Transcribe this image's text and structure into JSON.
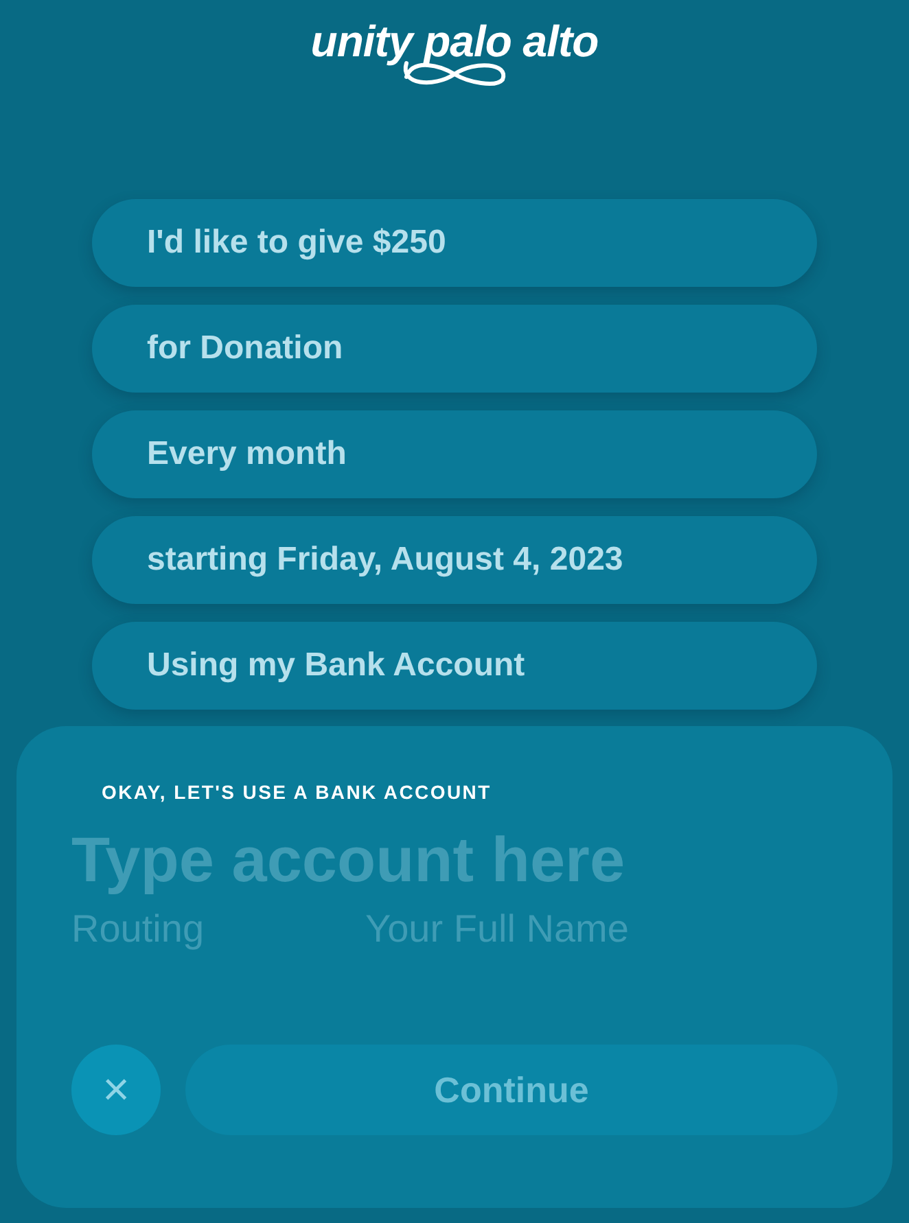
{
  "logo": {
    "text": "unity palo alto"
  },
  "choices": [
    {
      "label": "I'd like to give $250"
    },
    {
      "label": "for Donation"
    },
    {
      "label": "Every month"
    },
    {
      "label": "starting Friday, August 4, 2023"
    },
    {
      "label": "Using my Bank Account"
    }
  ],
  "panel": {
    "heading": "OKAY, LET'S USE A BANK ACCOUNT",
    "account": {
      "placeholder": "Type account here"
    },
    "routing": {
      "placeholder": "Routing"
    },
    "name": {
      "placeholder": "Your Full Name"
    },
    "close": {
      "icon": "×"
    },
    "continue": {
      "label": "Continue",
      "disabled": true
    }
  }
}
